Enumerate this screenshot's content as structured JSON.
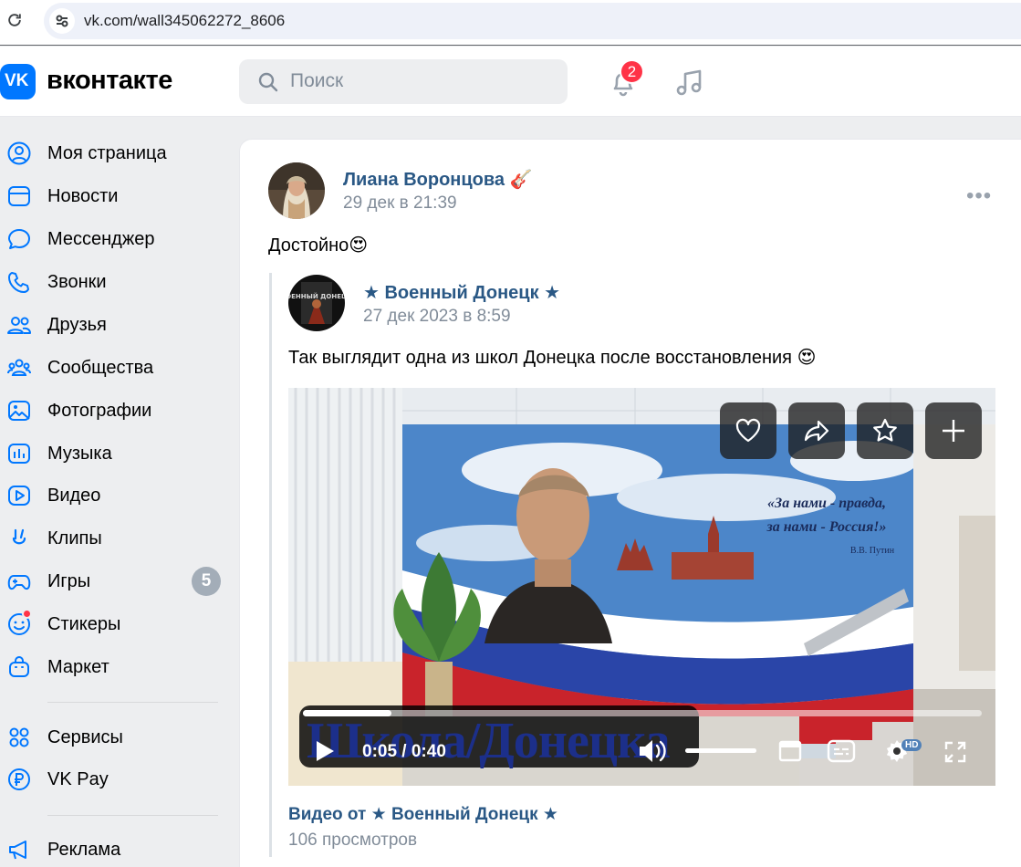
{
  "browser": {
    "url": "vk.com/wall345062272_8606",
    "reload_icon": "reload-icon",
    "site_info_icon": "tune-icon"
  },
  "header": {
    "logo_text": "VK",
    "brand": "вконтакте",
    "search_placeholder": "Поиск",
    "notifications_count": "2",
    "brand_color": "#0077ff"
  },
  "sidebar": {
    "items": [
      {
        "label": "Моя страница",
        "icon": "user-circle-icon"
      },
      {
        "label": "Новости",
        "icon": "news-icon"
      },
      {
        "label": "Мессенджер",
        "icon": "message-icon"
      },
      {
        "label": "Звонки",
        "icon": "phone-icon"
      },
      {
        "label": "Друзья",
        "icon": "friends-icon"
      },
      {
        "label": "Сообщества",
        "icon": "communities-icon"
      },
      {
        "label": "Фотографии",
        "icon": "photo-icon"
      },
      {
        "label": "Музыка",
        "icon": "music-icon"
      },
      {
        "label": "Видео",
        "icon": "video-icon"
      },
      {
        "label": "Клипы",
        "icon": "clips-icon"
      },
      {
        "label": "Игры",
        "icon": "gamepad-icon",
        "count": "5"
      },
      {
        "label": "Стикеры",
        "icon": "smile-icon"
      },
      {
        "label": "Маркет",
        "icon": "market-icon"
      },
      {
        "label": "Сервисы",
        "icon": "services-icon"
      },
      {
        "label": "VK Pay",
        "icon": "ruble-icon"
      },
      {
        "label": "Реклама",
        "icon": "megaphone-icon"
      }
    ]
  },
  "post": {
    "author": "Лиана Воронцова 🎸",
    "date": "29 дек в 21:39",
    "text": "Достойно😍",
    "more": "•••",
    "repost": {
      "author": "★ Военный Донецк ★",
      "date": "27 дек 2023 в 8:59",
      "text": "Так выглядит одна из школ Донецка после восстановления 😍",
      "avatar_text": "ВОЕННЫЙ ДОНЕЦК",
      "video": {
        "mural_quote_1": "«За нами - правда,",
        "mural_quote_2": "за нами - Россия!»",
        "mural_author": "В.В. Путин",
        "caption": "Школа/Донецка",
        "time": "0:05 / 0:40",
        "progress": 0.13,
        "volume": 1.0,
        "quality_badge": "HD"
      },
      "video_link": "Видео от ★ Военный Донецк ★",
      "views": "106 просмотров"
    }
  }
}
